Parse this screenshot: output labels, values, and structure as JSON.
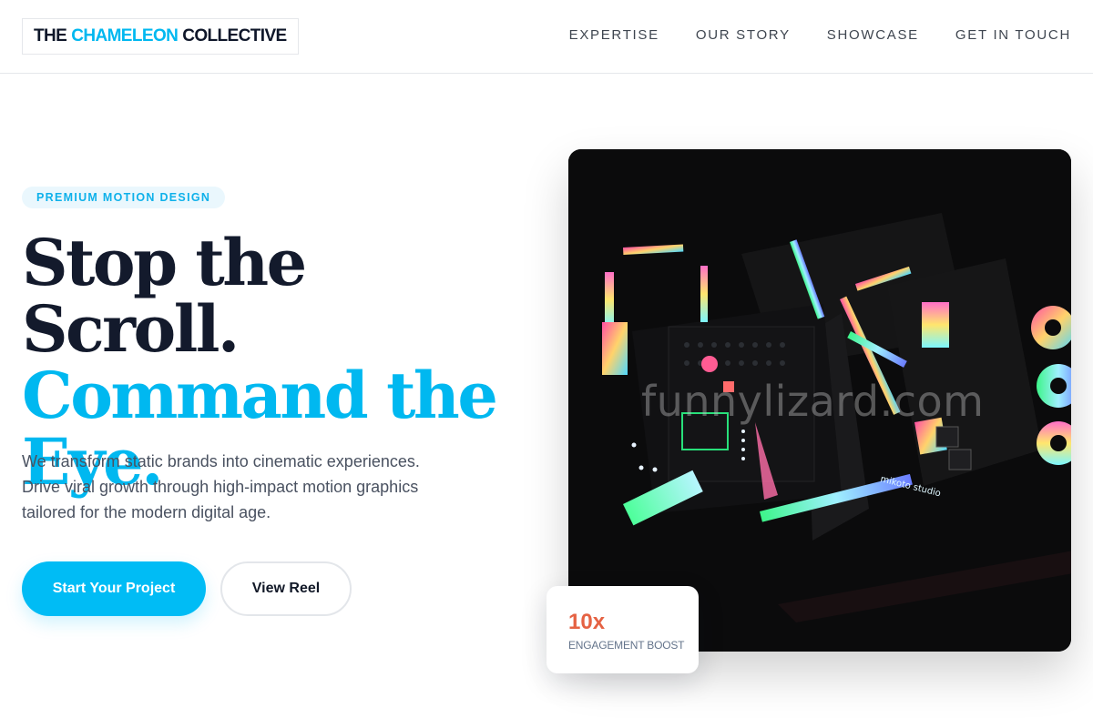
{
  "brand": {
    "part1": "THE",
    "part2": "CHAMELEON",
    "part3": "COLLECTIVE",
    "accent_color": "#00b8f0"
  },
  "nav": {
    "items": [
      {
        "label": "EXPERTISE"
      },
      {
        "label": "OUR STORY"
      },
      {
        "label": "SHOWCASE"
      },
      {
        "label": "GET IN TOUCH"
      }
    ]
  },
  "hero": {
    "badge": "PREMIUM MOTION DESIGN",
    "headline_line1": "Stop the Scroll.",
    "headline_line2": "Command the Eye.",
    "subtext": "We transform static brands into cinematic experiences. Drive viral growth through high-impact motion graphics tailored for the modern digital age.",
    "primary_button": "Start Your Project",
    "secondary_button": "View Reel"
  },
  "media": {
    "watermark": "funnylizard.com",
    "sign_text": "mikoto studio"
  },
  "stat": {
    "value": "10x",
    "label": "ENGAGEMENT BOOST",
    "value_color": "#e56243"
  }
}
